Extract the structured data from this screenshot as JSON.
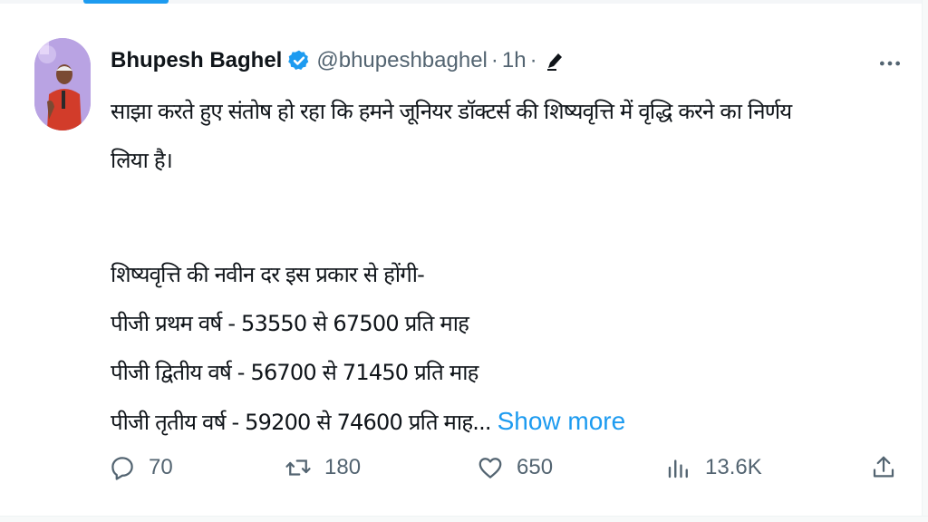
{
  "tweet": {
    "author_name": "Bhupesh Baghel",
    "handle": "@bhupeshbaghel",
    "separator": "·",
    "time": "1h",
    "separator2": "·",
    "body_lines": [
      "साझा करते हुए संतोष हो रहा कि हमने जूनियर डॉक्टर्स की शिष्यवृत्ति में वृद्धि करने का निर्णय",
      "लिया है।",
      "शिष्यवृत्ति की नवीन दर इस प्रकार से होंगी-",
      "पीजी प्रथम वर्ष - 53550 से 67500 प्रति माह",
      "पीजी द्वितीय वर्ष - 56700 से 71450 प्रति माह",
      "पीजी तृतीय वर्ष - 59200 से 74600 प्रति माह..."
    ],
    "show_more": "Show more"
  },
  "actions": {
    "replies": "70",
    "retweets": "180",
    "likes": "650",
    "views": "13.6K"
  },
  "icons": {
    "verified": "verified-badge-icon",
    "edit": "edit-pencil-icon",
    "more": "more-dots-icon",
    "reply": "reply-icon",
    "retweet": "retweet-icon",
    "like": "heart-icon",
    "views": "views-chart-icon",
    "share": "share-icon"
  },
  "colors": {
    "accent": "#1d9bf0",
    "text": "#0f1419",
    "secondary": "#536471"
  }
}
